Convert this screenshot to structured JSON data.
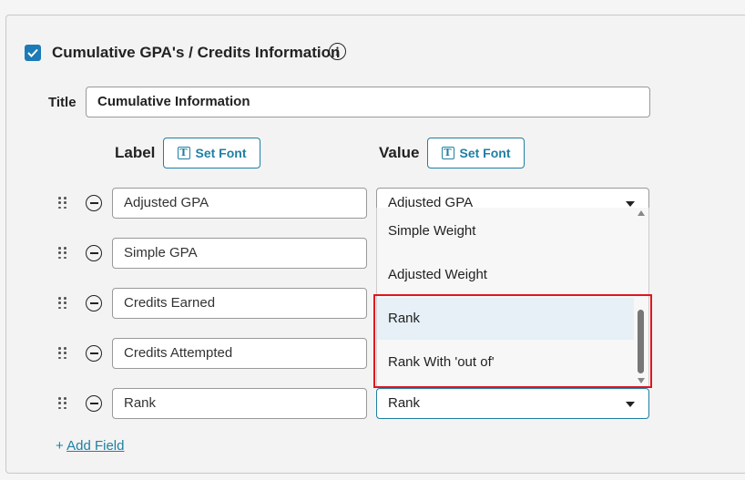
{
  "section": {
    "checkbox_checked": true,
    "title": "Cumulative GPA's / Credits Information",
    "info_icon": "info-icon"
  },
  "title_field": {
    "label": "Title",
    "value": "Cumulative Information"
  },
  "columns": {
    "label_heading": "Label",
    "value_heading": "Value",
    "set_font_label": "Set Font"
  },
  "rows": [
    {
      "label": "Adjusted GPA",
      "value": "Adjusted GPA"
    },
    {
      "label": "Simple GPA"
    },
    {
      "label": "Credits Earned"
    },
    {
      "label": "Credits Attempted"
    },
    {
      "label": "Rank",
      "value": "Rank"
    }
  ],
  "dropdown": {
    "options": [
      "Simple Weight",
      "Adjusted Weight",
      "Rank",
      "Rank With 'out of'"
    ],
    "hovered": "Rank"
  },
  "add_field": {
    "plus": "+",
    "label": "Add Field"
  },
  "colors": {
    "accent": "#1f7fa3",
    "checkbox": "#1c7ab7",
    "highlight": "#e0151f"
  }
}
